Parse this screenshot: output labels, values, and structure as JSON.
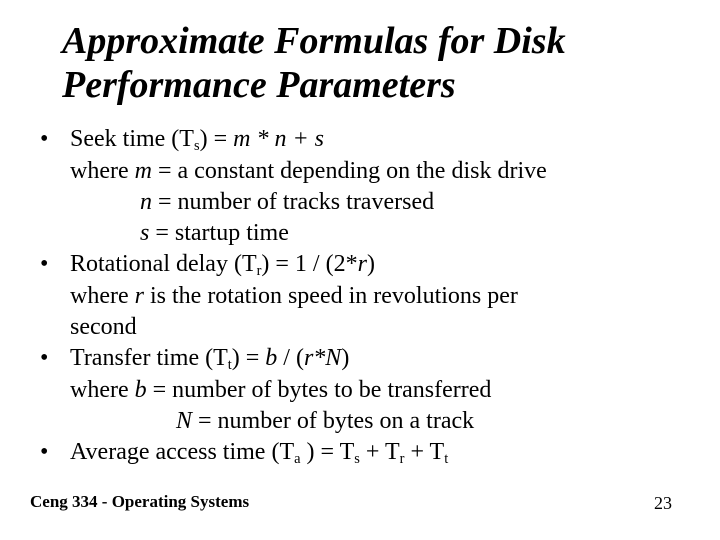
{
  "title_line1": "Approximate Formulas for Disk",
  "title_line2": "Performance Parameters",
  "b1": {
    "l1a": "Seek time (T",
    "l1b": ") = ",
    "l1c": "m  * n + s",
    "l2a": "where ",
    "l2b": "m",
    "l2c": " = a constant depending on the disk drive",
    "l3a": "n",
    "l3b": "  = number of tracks traversed",
    "l4a": "s",
    "l4b": "  =  startup time",
    "sub": "s"
  },
  "b2": {
    "l1a": "Rotational delay (T",
    "l1b": ") =  1 / (2*",
    "l1c": "r",
    "l1d": ")",
    "l2a": "where ",
    "l2b": "r",
    "l2c": " is the rotation speed in revolutions per",
    "l3": "second",
    "sub": "r"
  },
  "b3": {
    "l1a": "Transfer time (T",
    "l1b": ") = ",
    "l1c": "b",
    "l1d": " / (",
    "l1e": "r*N",
    "l1f": ")",
    "l2a": "where ",
    "l2b": "b",
    "l2c": "  = number of bytes to be transferred",
    "l3a": "N",
    "l3b": " = number of bytes on a track",
    "sub": "t"
  },
  "b4": {
    "l1a": "Average access time (T",
    "l1b": " ) = T",
    "l1c": "  + T",
    "l1d": "  +  T",
    "sub_a": "a",
    "sub_s": "s",
    "sub_r": "r",
    "sub_t": "t"
  },
  "footer_left": "Ceng 334 - Operating Systems",
  "footer_right": "23",
  "bullet": "•"
}
